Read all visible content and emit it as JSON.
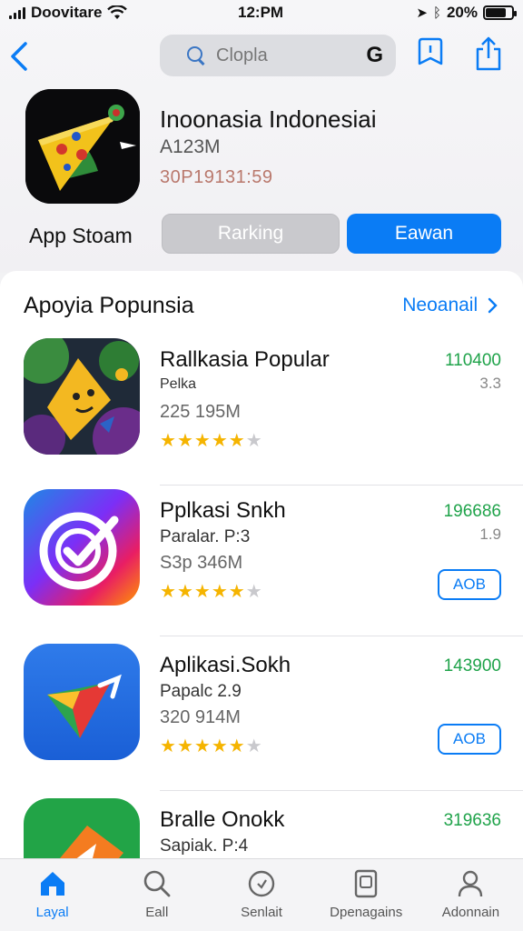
{
  "status_bar": {
    "carrier": "Doovitare",
    "time": "12:PM",
    "battery": "20%"
  },
  "header": {
    "search_placeholder": "Clopla",
    "search_badge": "G"
  },
  "featured": {
    "title": "Inoonasia Indonesiai",
    "size": "A123M",
    "code": "30P19131:59",
    "store_label": "App Stoam",
    "secondary_button": "Rarking",
    "primary_button": "Eawan"
  },
  "section": {
    "title": "Apoyia Popunsia",
    "see_all": "Neoanail"
  },
  "apps": [
    {
      "title": "Rallkasia Popular",
      "subtitle": "Pelka",
      "size": "225 195M",
      "count": "110400",
      "rating_text": "3.3",
      "stars": 4.5,
      "button": ""
    },
    {
      "title": "Pplkasi Snkh",
      "subtitle": "Paralar. P:3",
      "size": "S3p 346M",
      "count": "196686",
      "rating_text": "1.9",
      "stars": 4.5,
      "button": "AOB"
    },
    {
      "title": "Aplikasi.Sokh",
      "subtitle": "Papalc 2.9",
      "size": "320 914M",
      "count": "143900",
      "rating_text": "",
      "stars": 4.5,
      "button": "AOB"
    },
    {
      "title": "Bralle Onokk",
      "subtitle": "Sapiak. P:4",
      "size": "",
      "count": "319636",
      "rating_text": "",
      "stars": 0,
      "button": ""
    }
  ],
  "tabs": [
    {
      "label": "Layal",
      "icon": "home-icon",
      "active": true
    },
    {
      "label": "Eall",
      "icon": "search-icon",
      "active": false
    },
    {
      "label": "Senlait",
      "icon": "apps-icon",
      "active": false
    },
    {
      "label": "Dpenagains",
      "icon": "library-icon",
      "active": false
    },
    {
      "label": "Adonnain",
      "icon": "profile-icon",
      "active": false
    }
  ],
  "colors": {
    "accent": "#0a7cf5",
    "count_green": "#1fa34a",
    "star": "#f5b400"
  }
}
